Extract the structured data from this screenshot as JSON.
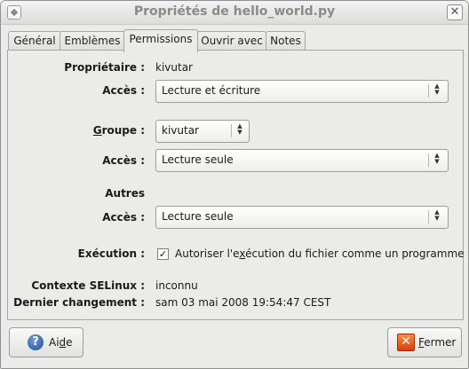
{
  "window": {
    "title": "Propriétés de hello_world.py"
  },
  "tabs": [
    {
      "label": "Général"
    },
    {
      "label": "Emblèmes"
    },
    {
      "label": "Permissions"
    },
    {
      "label": "Ouvrir avec"
    },
    {
      "label": "Notes"
    }
  ],
  "active_tab": "Permissions",
  "owner": {
    "label": "Propriétaire :",
    "value": "kivutar",
    "access_label": "Accès :",
    "access_value": "Lecture et écriture"
  },
  "group": {
    "label_before": "",
    "label_mnemonic": "G",
    "label_after": "roupe :",
    "value": "kivutar",
    "access_label": "Accès :",
    "access_value": "Lecture seule"
  },
  "others": {
    "label": "Autres",
    "access_label": "Accès :",
    "access_value": "Lecture seule"
  },
  "execution": {
    "label": "Exécution :",
    "checkbox_checked": true,
    "checkbox_label_before": "Autoriser l'e",
    "checkbox_label_mnemonic": "x",
    "checkbox_label_after": "écution du fichier comme un programme"
  },
  "selinux": {
    "label": "Contexte SELinux :",
    "value": "inconnu"
  },
  "last_change": {
    "label": "Dernier changement :",
    "value": "sam 03 mai 2008 19:54:47 CEST"
  },
  "buttons": {
    "help_before": "Ai",
    "help_mnemonic": "d",
    "help_after": "e",
    "close_before": "",
    "close_mnemonic": "F",
    "close_after": "ermer"
  },
  "icons": {
    "window": "window-menu-icon",
    "close": "close-icon",
    "help": "help-icon",
    "close_button": "close-red-icon",
    "dropdown": "updown-arrows-icon",
    "check": "checkmark-icon"
  }
}
